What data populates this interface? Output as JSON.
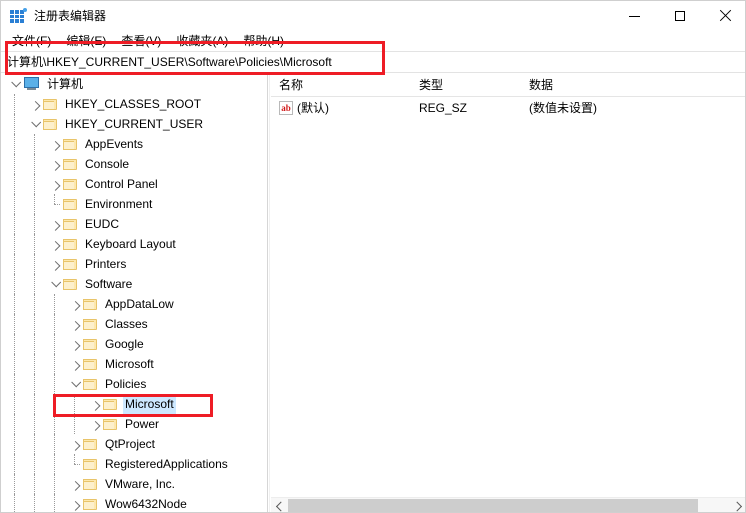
{
  "window": {
    "title": "注册表编辑器",
    "icon": "registry-editor-icon",
    "minimize_label": "最小化",
    "maximize_label": "最大化",
    "close_label": "关闭"
  },
  "menubar": {
    "items": [
      {
        "label": "文件(F)"
      },
      {
        "label": "编辑(E)"
      },
      {
        "label": "查看(V)"
      },
      {
        "label": "收藏夹(A)"
      },
      {
        "label": "帮助(H)"
      }
    ]
  },
  "address": {
    "path": "计算机\\HKEY_CURRENT_USER\\Software\\Policies\\Microsoft"
  },
  "annotations": {
    "accent_color": "#ee1c25",
    "address_highlight": "address-bar-path",
    "tree_highlight": "tree-node-policies-microsoft"
  },
  "tree": {
    "nodes": [
      {
        "label": "计算机",
        "depth": 0,
        "state": "expanded",
        "icon": "computer-icon",
        "selected": false
      },
      {
        "label": "HKEY_CLASSES_ROOT",
        "depth": 1,
        "state": "collapsed",
        "icon": "folder-icon",
        "selected": false
      },
      {
        "label": "HKEY_CURRENT_USER",
        "depth": 1,
        "state": "expanded",
        "icon": "folder-icon",
        "selected": false
      },
      {
        "label": "AppEvents",
        "depth": 2,
        "state": "collapsed",
        "icon": "folder-icon",
        "selected": false
      },
      {
        "label": "Console",
        "depth": 2,
        "state": "collapsed",
        "icon": "folder-icon",
        "selected": false
      },
      {
        "label": "Control Panel",
        "depth": 2,
        "state": "collapsed",
        "icon": "folder-icon",
        "selected": false
      },
      {
        "label": "Environment",
        "depth": 2,
        "state": "leaf",
        "icon": "folder-icon",
        "selected": false
      },
      {
        "label": "EUDC",
        "depth": 2,
        "state": "collapsed",
        "icon": "folder-icon",
        "selected": false
      },
      {
        "label": "Keyboard Layout",
        "depth": 2,
        "state": "collapsed",
        "icon": "folder-icon",
        "selected": false
      },
      {
        "label": "Printers",
        "depth": 2,
        "state": "collapsed",
        "icon": "folder-icon",
        "selected": false
      },
      {
        "label": "Software",
        "depth": 2,
        "state": "expanded",
        "icon": "folder-icon",
        "selected": false
      },
      {
        "label": "AppDataLow",
        "depth": 3,
        "state": "collapsed",
        "icon": "folder-icon",
        "selected": false
      },
      {
        "label": "Classes",
        "depth": 3,
        "state": "collapsed",
        "icon": "folder-icon",
        "selected": false
      },
      {
        "label": "Google",
        "depth": 3,
        "state": "collapsed",
        "icon": "folder-icon",
        "selected": false
      },
      {
        "label": "Microsoft",
        "depth": 3,
        "state": "collapsed",
        "icon": "folder-icon",
        "selected": false
      },
      {
        "label": "Policies",
        "depth": 3,
        "state": "expanded",
        "icon": "folder-icon",
        "selected": false
      },
      {
        "label": "Microsoft",
        "depth": 4,
        "state": "collapsed",
        "icon": "folder-icon",
        "selected": true
      },
      {
        "label": "Power",
        "depth": 4,
        "state": "collapsed",
        "icon": "folder-icon",
        "selected": false
      },
      {
        "label": "QtProject",
        "depth": 3,
        "state": "collapsed",
        "icon": "folder-icon",
        "selected": false
      },
      {
        "label": "RegisteredApplications",
        "depth": 3,
        "state": "leaf",
        "icon": "folder-icon",
        "selected": false
      },
      {
        "label": "VMware, Inc.",
        "depth": 3,
        "state": "collapsed",
        "icon": "folder-icon",
        "selected": false
      },
      {
        "label": "Wow6432Node",
        "depth": 3,
        "state": "collapsed",
        "icon": "folder-icon",
        "selected": false
      }
    ]
  },
  "values_list": {
    "columns": [
      "名称",
      "类型",
      "数据"
    ],
    "rows": [
      {
        "name": "(默认)",
        "type": "REG_SZ",
        "data": "(数值未设置)",
        "icon": "string-value-icon",
        "icon_text": "ab"
      }
    ]
  }
}
